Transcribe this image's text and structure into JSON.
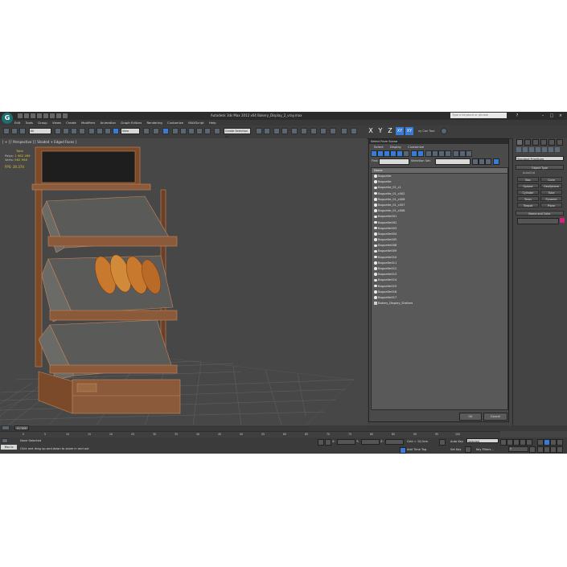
{
  "window": {
    "title": "Autodesk 3ds Max  2012 x64     Bakery_Display_2_vray.max",
    "search_placeholder": "Type a keyword or phrase",
    "logo_glyph": "G"
  },
  "menu": [
    "Edit",
    "Tools",
    "Group",
    "Views",
    "Create",
    "Modifiers",
    "Animation",
    "Graph Editors",
    "Rendering",
    "Customize",
    "MAXScript",
    "Help"
  ],
  "toolbar": {
    "filter_dropdown": "All",
    "view_dropdown": "View",
    "named_selection": "Create Selection Se",
    "axes": [
      "X",
      "Y",
      "Z",
      "XY",
      "XY"
    ],
    "active_axis_index": 3,
    "key_tools": "xy Can Tool"
  },
  "viewport": {
    "label": "[ + ] [ Perspective ] [ Shaded + Edged Faces ]",
    "stats_header": "Total",
    "polys_label": "Polys:",
    "polys_value": "1 962 269",
    "verts_label": "Verts:",
    "verts_value": "962 998",
    "fps_label": "FPS:",
    "fps_value": "39.374"
  },
  "select_dialog": {
    "title": "Select From Scene",
    "menus": [
      "Select",
      "Display",
      "Customize"
    ],
    "find_label": "Find:",
    "selection_set_label": "Selection Set:",
    "column_name": "Name",
    "items": [
      "Baguette",
      "Baguette",
      "Baguette_01_c1",
      "Baguette_01_c002",
      "Baguette_01_c006",
      "Baguette_01_c007",
      "Baguette_01_c008",
      "Baguette001",
      "Baguette002",
      "Baguette003",
      "Baguette004",
      "Baguette005",
      "Baguette008",
      "Baguette009",
      "Baguette010",
      "Baguette011",
      "Baguette012",
      "Baguette013",
      "Baguette014",
      "Baguette015",
      "Baguette016",
      "Baguette017",
      "Bakery_Display_Shelves"
    ],
    "ok_label": "OK",
    "cancel_label": "Cancel"
  },
  "command_panel": {
    "category_dropdown": "Standard Primitives",
    "object_type_header": "Object Type",
    "autogrid_label": "AutoGrid",
    "object_buttons": [
      "Box",
      "Cone",
      "Sphere",
      "GeoSphere",
      "Cylinder",
      "Tube",
      "Torus",
      "Pyramid",
      "Teapot",
      "Plane"
    ],
    "name_color_header": "Name and Color",
    "swatch_color": "#d0237b"
  },
  "timeline": {
    "slider_label": "0 / 100",
    "ticks": [
      "0",
      "5",
      "10",
      "15",
      "20",
      "25",
      "30",
      "35",
      "40",
      "45",
      "50",
      "55",
      "60",
      "65",
      "70",
      "75",
      "80",
      "85",
      "90",
      "95",
      "100"
    ]
  },
  "status": {
    "welcome": "Max to",
    "selection_text": "None Selected",
    "prompt_text": "Click and drag up-and-down to zoom in and out",
    "x_label": "X:",
    "y_label": "Y:",
    "z_label": "Z:",
    "grid_text": "Grid = 10,0cm",
    "add_time_tag": "Add Time Tag",
    "auto_key": "Auto Key",
    "set_key": "Set Key",
    "key_filters": "Key Filters...",
    "selected_dropdown": "Selected",
    "frame_value": "0"
  },
  "colors": {
    "accent": "#3a7bd5",
    "viewport_bg": "#474747",
    "shelf_wood": "#8a5a3a",
    "bread": "#c8792e"
  }
}
